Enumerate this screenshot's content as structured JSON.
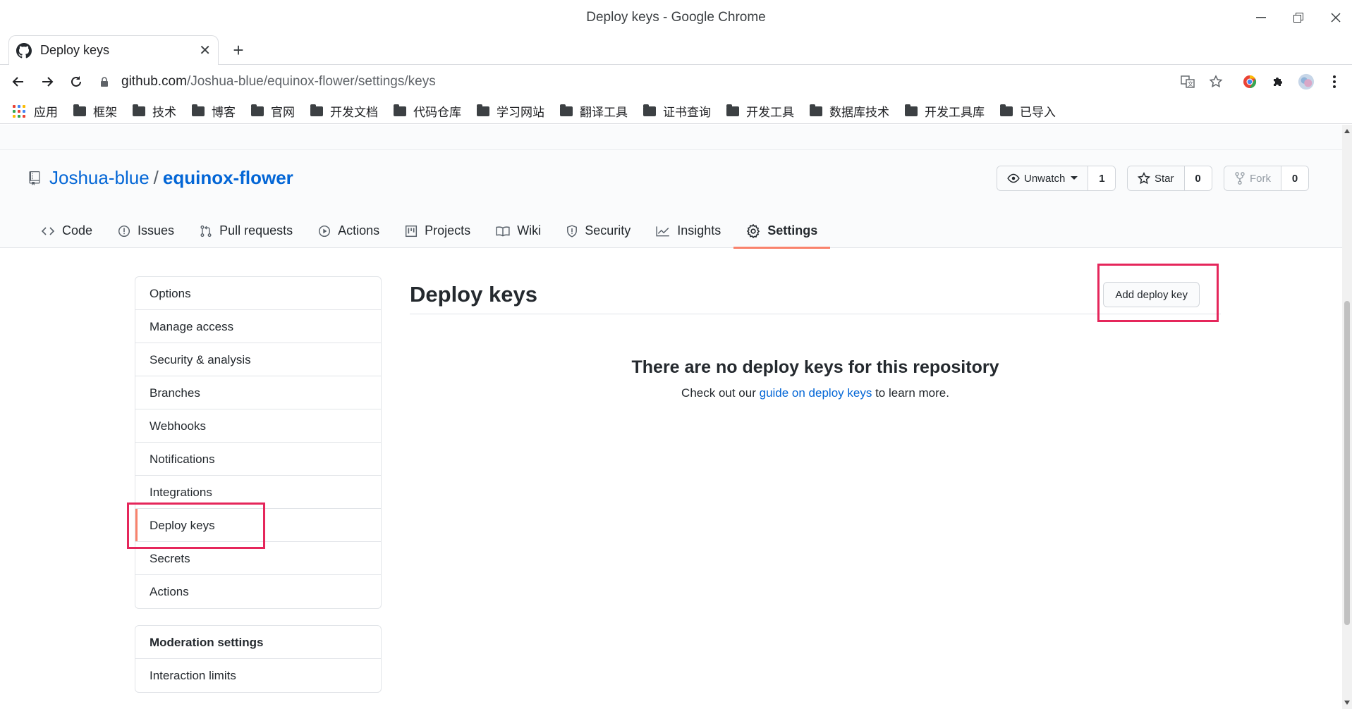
{
  "window": {
    "title": "Deploy keys - Google Chrome"
  },
  "tab": {
    "title": "Deploy keys",
    "close": "✕"
  },
  "address": {
    "host": "github.com",
    "path": "/Joshua-blue/equinox-flower/settings/keys"
  },
  "bookmarks": {
    "apps_label": "应用",
    "folders": [
      "框架",
      "技术",
      "博客",
      "官网",
      "开发文档",
      "代码仓库",
      "学习网站",
      "翻译工具",
      "证书查询",
      "开发工具",
      "数据库技术",
      "开发工具库",
      "已导入"
    ]
  },
  "repo": {
    "owner": "Joshua-blue",
    "separator": "/",
    "name": "equinox-flower",
    "watch_label": "Unwatch",
    "watch_count": "1",
    "star_label": "Star",
    "star_count": "0",
    "fork_label": "Fork",
    "fork_count": "0"
  },
  "nav": {
    "code": "Code",
    "issues": "Issues",
    "pulls": "Pull requests",
    "actions": "Actions",
    "projects": "Projects",
    "wiki": "Wiki",
    "security": "Security",
    "insights": "Insights",
    "settings": "Settings"
  },
  "sidebar": {
    "items": [
      "Options",
      "Manage access",
      "Security & analysis",
      "Branches",
      "Webhooks",
      "Notifications",
      "Integrations",
      "Deploy keys",
      "Secrets",
      "Actions"
    ],
    "moderation_heading": "Moderation settings",
    "moderation_items": [
      "Interaction limits"
    ]
  },
  "main": {
    "title": "Deploy keys",
    "add_button": "Add deploy key",
    "empty_title": "There are no deploy keys for this repository",
    "empty_prefix": "Check out our ",
    "empty_link": "guide on deploy keys",
    "empty_suffix": " to learn more."
  },
  "colors": {
    "link": "#0366d6",
    "selected_underline": "#f9826c",
    "annotation": "#e5265b"
  }
}
